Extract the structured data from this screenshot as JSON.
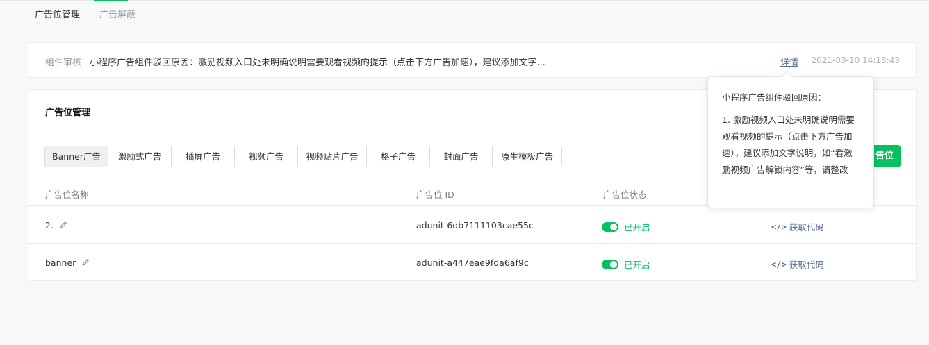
{
  "tabs": [
    {
      "label": "广告位管理",
      "active": true
    },
    {
      "label": "广告屏蔽",
      "active": false
    }
  ],
  "notice": {
    "tag": "组件审核",
    "text": "小程序广告组件驳回原因：激励视频入口处未明确说明需要观看视频的提示（点击下方广告加速），建议添加文字...",
    "link": "详情",
    "time": "2021-03-10 14:18:43"
  },
  "card": {
    "title": "广告位管理",
    "segments": [
      {
        "label": "Banner广告",
        "active": true
      },
      {
        "label": "激励式广告",
        "active": false
      },
      {
        "label": "插屏广告",
        "active": false
      },
      {
        "label": "视频广告",
        "active": false
      },
      {
        "label": "视频贴片广告",
        "active": false
      },
      {
        "label": "格子广告",
        "active": false
      },
      {
        "label": "封面广告",
        "active": false
      },
      {
        "label": "原生模板广告",
        "active": false
      }
    ],
    "add_button": "告位"
  },
  "table": {
    "headers": {
      "name": "广告位名称",
      "id": "广告位 ID",
      "status": "广告位状态"
    },
    "rows": [
      {
        "name": "2.",
        "id": "adunit-6db7111103cae55c",
        "status": "已开启",
        "action": "获取代码"
      },
      {
        "name": "banner",
        "id": "adunit-a447eae9fda6af9c",
        "status": "已开启",
        "action": "获取代码"
      }
    ]
  },
  "popover": {
    "title": "小程序广告组件驳回原因：",
    "body": "1. 激励视频入口处未明确说明需要观看视频的提示（点击下方广告加速），建议添加文字说明，如“看激励视频广告解锁内容”等，请整改"
  },
  "colors": {
    "accent": "#07c160",
    "link": "#576b95"
  }
}
